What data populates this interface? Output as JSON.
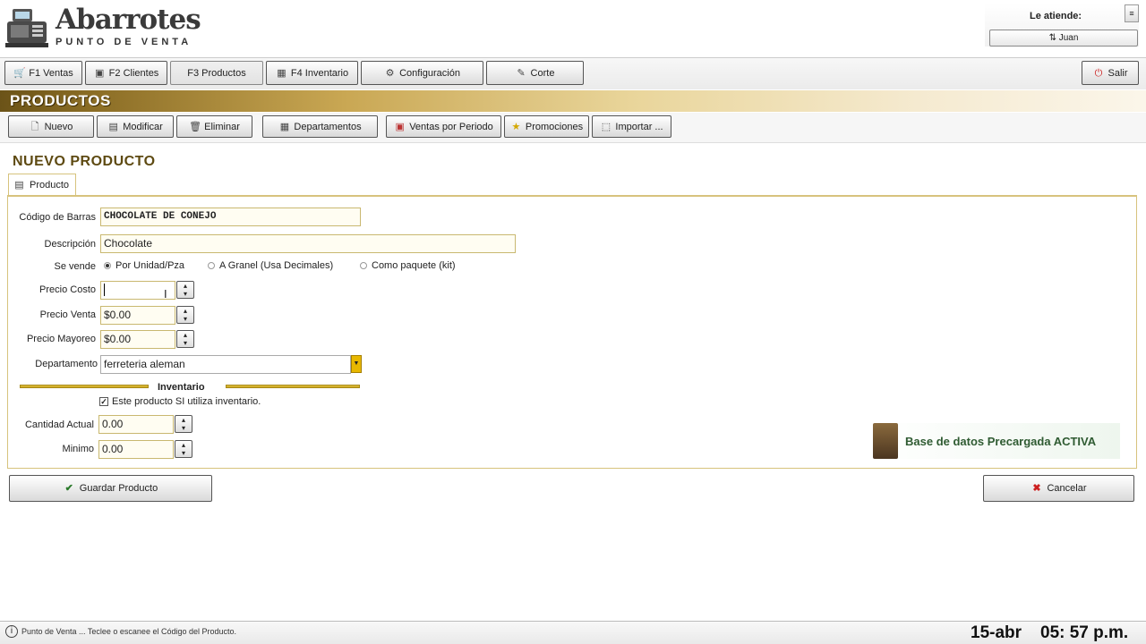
{
  "header": {
    "logo_title": "Abarrotes",
    "logo_subtitle": "PUNTO DE VENTA",
    "attends_label": "Le atiende:",
    "user_name": "Juan",
    "window_button": "≡"
  },
  "nav": {
    "tabs": [
      {
        "label": "F1 Ventas",
        "icon": "cart-icon"
      },
      {
        "label": "F2 Clientes",
        "icon": "clients-icon"
      },
      {
        "label": "F3 Productos",
        "icon": "products-icon"
      },
      {
        "label": "F4 Inventario",
        "icon": "inventory-icon"
      },
      {
        "label": "Configuración",
        "icon": "gear-icon"
      },
      {
        "label": "Corte",
        "icon": "cut-icon"
      }
    ],
    "exit_label": "Salir"
  },
  "section": {
    "title": "PRODUCTOS"
  },
  "toolbar": {
    "buttons": [
      {
        "label": "Nuevo"
      },
      {
        "label": "Modificar"
      },
      {
        "label": "Eliminar"
      },
      {
        "label": "Departamentos"
      },
      {
        "label": "Ventas por Periodo"
      },
      {
        "label": "Promociones"
      },
      {
        "label": "Importar ..."
      }
    ]
  },
  "form": {
    "title": "NUEVO PRODUCTO",
    "tab_label": "Producto",
    "barcode_label": "Código de Barras",
    "barcode_value": "CHOCOLATE DE CONEJO",
    "description_label": "Descripción",
    "description_value": "Chocolate",
    "sold_label": "Se vende",
    "sold_options": [
      {
        "label": "Por Unidad/Pza",
        "selected": true
      },
      {
        "label": "A Granel (Usa Decimales)",
        "selected": false
      },
      {
        "label": "Como paquete (kit)",
        "selected": false
      }
    ],
    "cost_label": "Precio Costo",
    "cost_value": "",
    "sale_label": "Precio Venta",
    "sale_value": "$0.00",
    "wholesale_label": "Precio Mayoreo",
    "wholesale_value": "$0.00",
    "department_label": "Departamento",
    "department_value": "ferreteria aleman",
    "inventory_heading": "Inventario",
    "inventory_check_label": "Este producto SI utiliza inventario.",
    "inventory_checked": true,
    "current_qty_label": "Cantidad Actual",
    "current_qty_value": "0.00",
    "minimum_label": "Minimo",
    "minimum_value": "0.00",
    "db_notice": "Base de datos Precargada ACTIVA",
    "save_label": "Guardar Producto",
    "cancel_label": "Cancelar"
  },
  "status": {
    "message": "Punto de Venta ... Teclee o escanee el Código del Producto.",
    "date": "15-abr",
    "time": "05: 57 p.m."
  },
  "colors": {
    "accent_gold": "#c9a753",
    "title_brown": "#5e4a12",
    "notice_green": "#2f5b32",
    "cancel_red": "#cc1f1f"
  }
}
